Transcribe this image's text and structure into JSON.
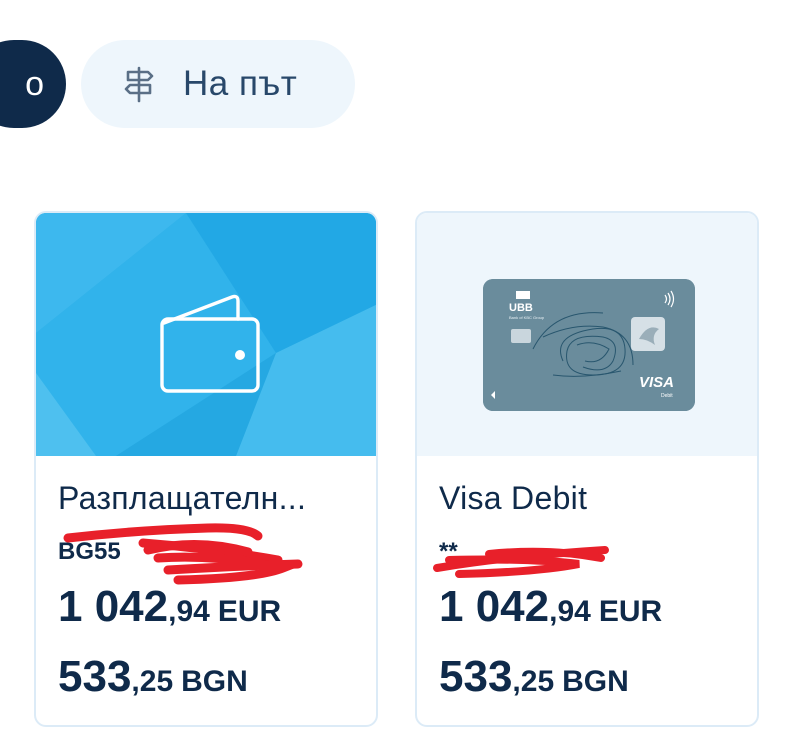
{
  "chips": [
    {
      "label": "о",
      "active": true
    },
    {
      "label": "На път",
      "icon": "signpost-icon",
      "active": false
    }
  ],
  "cards": [
    {
      "name": "Разплащателн...",
      "number": "BG55",
      "media_icon": "wallet-icon",
      "balance_eur": {
        "int": "1 042",
        "dec": ",94",
        "cur": "EUR"
      },
      "balance_bgn": {
        "int": "533",
        "dec": ",25",
        "cur": "BGN"
      }
    },
    {
      "name": "Visa Debit",
      "number": "**",
      "card_bank": "UBB",
      "card_bank_sub": "Bank of KBC Group",
      "card_brand": "VISA",
      "card_brand_sub": "Debit",
      "balance_eur": {
        "int": "1 042",
        "dec": ",94",
        "cur": "EUR"
      },
      "balance_bgn": {
        "int": "533",
        "dec": ",25",
        "cur": "BGN"
      }
    }
  ],
  "colors": {
    "navy": "#0f2a4a",
    "account_media": "#2cb0ea",
    "card_media": "#eef6fc",
    "redaction": "#e8202a"
  }
}
